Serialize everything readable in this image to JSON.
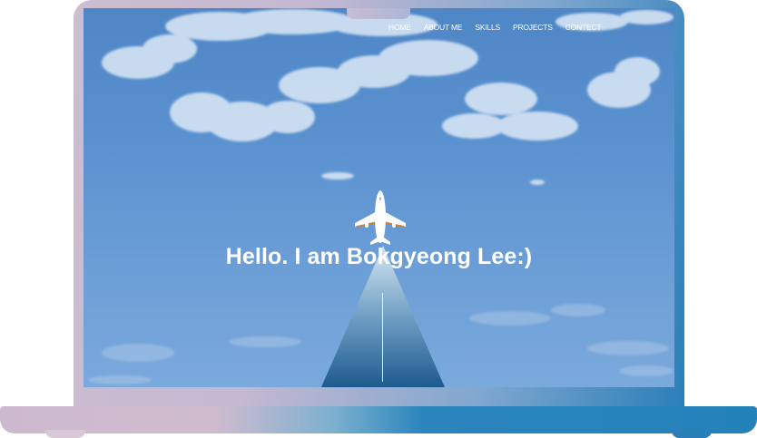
{
  "nav": {
    "items": [
      {
        "label": "HOME"
      },
      {
        "label": "ABOUT ME"
      },
      {
        "label": "SKILLS"
      },
      {
        "label": "PROJECTS"
      },
      {
        "label": "CONTECT"
      }
    ]
  },
  "hero": {
    "title": "Hello. I am Bokgyeong Lee:)"
  },
  "icons": {
    "plane": "airplane-icon"
  },
  "colors": {
    "sky": "#5a91cf",
    "beam_top": "#cfe3f1",
    "beam_bottom": "#1e5a8e",
    "text": "#ffffff"
  }
}
